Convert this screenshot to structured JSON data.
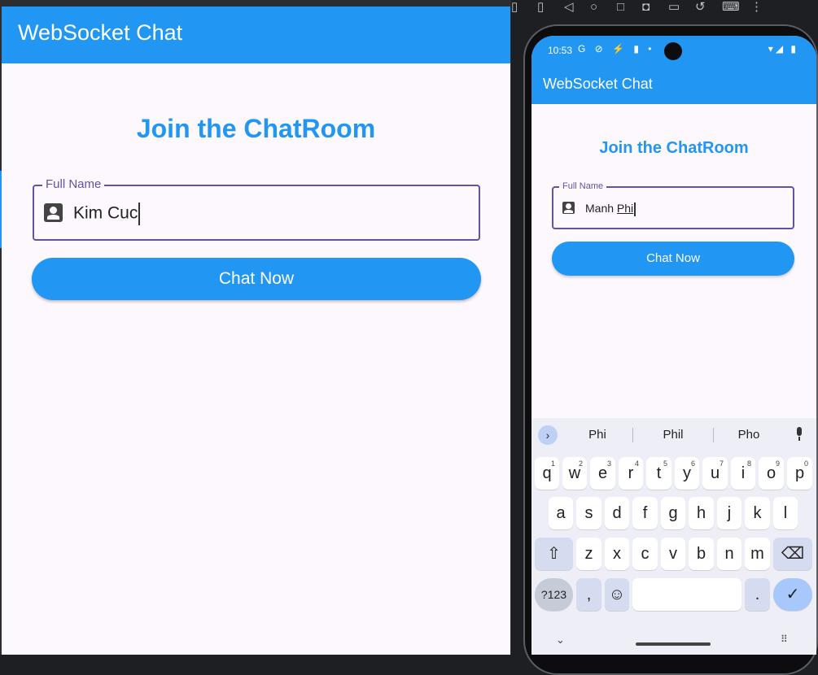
{
  "desktop": {
    "appbar_title": "WebSocket Chat",
    "join_title": "Join the ChatRoom",
    "field_label": "Full Name",
    "field_value": "Kim Cuc",
    "button_label": "Chat Now"
  },
  "emulator_toolbar": {
    "icons": [
      "rotate-left-icon",
      "rotate-right-icon",
      "back-icon",
      "home-icon",
      "overview-icon",
      "camera-icon",
      "record-icon",
      "replay-icon",
      "keyboard-settings-icon",
      "more-icon"
    ]
  },
  "phone": {
    "status_time": "10:53",
    "status_left_icons": "G ⊘ ⚡ ▮ •",
    "status_right_icons": "▾◢ ▮",
    "appbar_title": "WebSocket Chat",
    "join_title": "Join the ChatRoom",
    "field_label": "Full Name",
    "field_value_first": "Manh",
    "field_value_last": "Phi",
    "button_label": "Chat Now"
  },
  "keyboard": {
    "suggestions": [
      "Phi",
      "Phil",
      "Pho"
    ],
    "row1": [
      "q",
      "w",
      "e",
      "r",
      "t",
      "y",
      "u",
      "i",
      "o",
      "p"
    ],
    "row1_hints": [
      "1",
      "2",
      "3",
      "4",
      "5",
      "6",
      "7",
      "8",
      "9",
      "0"
    ],
    "row2": [
      "a",
      "s",
      "d",
      "f",
      "g",
      "h",
      "j",
      "k",
      "l"
    ],
    "row3": [
      "z",
      "x",
      "c",
      "v",
      "b",
      "n",
      "m"
    ],
    "symbols_key": "?123",
    "comma_key": ",",
    "period_key": ".",
    "shift_glyph": "⇧",
    "backspace_glyph": "⌫",
    "emoji_glyph": "☺",
    "enter_glyph": "✓",
    "expand_glyph": "›",
    "nav_down_glyph": "⌄",
    "nav_grid_glyph": "⠿"
  },
  "colors": {
    "brand_blue": "#2196f3",
    "focus_purple": "#6750a4",
    "keyboard_bg": "#edeef6",
    "enter_key": "#a8c7fa"
  }
}
